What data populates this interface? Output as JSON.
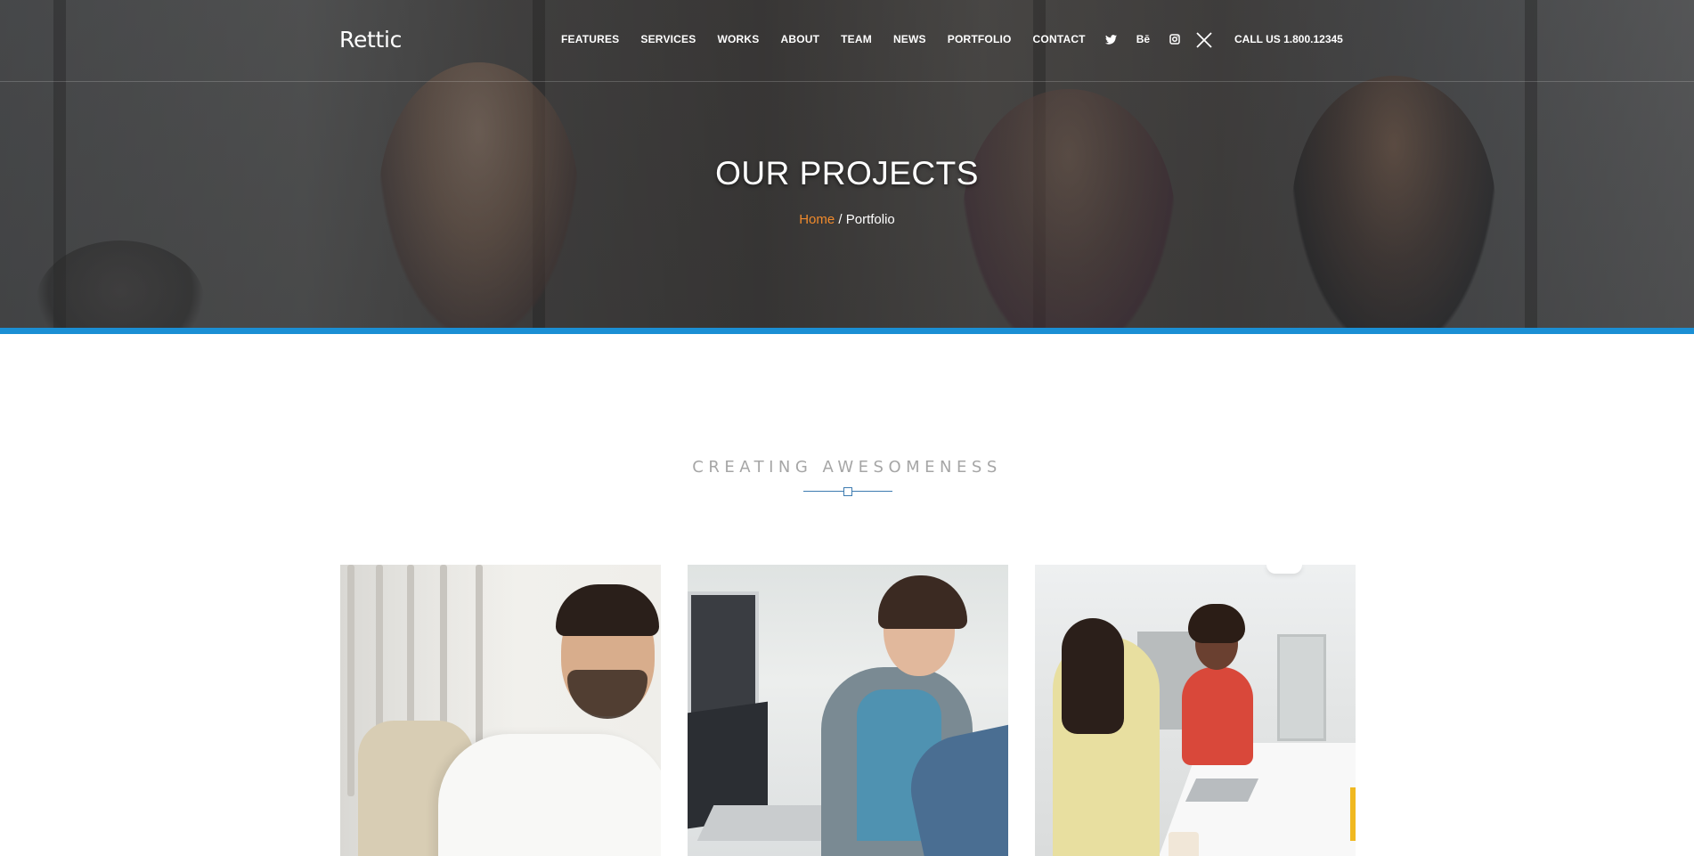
{
  "header": {
    "logo": "Rettic",
    "nav": [
      "FEATURES",
      "SERVICES",
      "WORKS",
      "ABOUT",
      "TEAM",
      "NEWS",
      "PORTFOLIO",
      "CONTACT"
    ],
    "social": [
      {
        "icon": "twitter-icon",
        "glyph": ""
      },
      {
        "icon": "behance-icon",
        "glyph": "Bē"
      },
      {
        "icon": "instagram-icon",
        "glyph": ""
      }
    ],
    "call": "CALL US 1.800.12345"
  },
  "hero": {
    "title": "OUR PROJECTS",
    "breadcrumb": {
      "home": "Home",
      "separator": " / ",
      "current": "Portfolio"
    }
  },
  "section": {
    "heading": "CREATING AWESOMENESS"
  },
  "colors": {
    "accent_blue": "#1b8fd4",
    "breadcrumb_orange": "#f08a2c",
    "heading_gray": "#a6a6a6"
  }
}
